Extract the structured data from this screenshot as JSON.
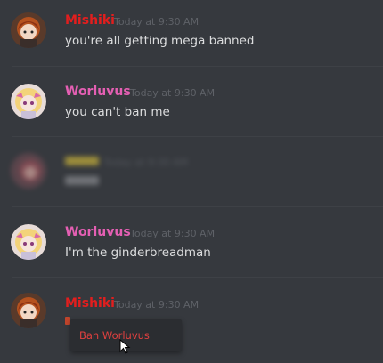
{
  "messages": [
    {
      "username": "Mishiki",
      "username_color": "#e21e1e",
      "timestamp": "Today at 9:30 AM",
      "text": "you're all getting mega banned",
      "avatar": "mishiki-avatar"
    },
    {
      "username": "Worluvus",
      "username_color": "#e45fb3",
      "timestamp": "Today at 9:30 AM",
      "text": "you can't ban me",
      "avatar": "worluvus-avatar"
    },
    {
      "username": "",
      "username_color": "#c9b23a",
      "timestamp": "Today at 9:30 AM",
      "text": "",
      "avatar": "blurred-avatar"
    },
    {
      "username": "Worluvus",
      "username_color": "#e45fb3",
      "timestamp": "Today at 9:30 AM",
      "text": "I'm the ginderbreadman",
      "avatar": "worluvus-avatar"
    },
    {
      "username": "Mishiki",
      "username_color": "#e21e1e",
      "timestamp": "Today at 9:30 AM",
      "text": "",
      "avatar": "mishiki-avatar"
    }
  ],
  "context_menu": {
    "items": [
      {
        "label": "Ban Worluvus",
        "color": "#e0403f"
      }
    ]
  },
  "colors": {
    "background": "#36393e",
    "divider": "#3e4146",
    "text": "#dcddde",
    "timestamp": "#5e6167"
  }
}
